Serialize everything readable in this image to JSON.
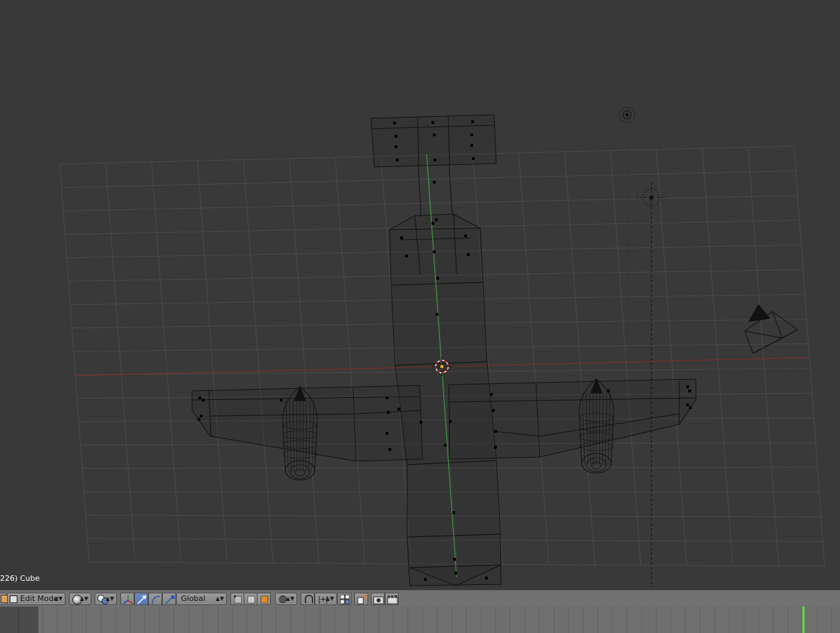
{
  "viewport": {
    "object_label": "226) Cube",
    "colors": {
      "background": "#393939",
      "grid": "#4a4a4a",
      "x_axis": "#8b2a2a",
      "y_axis": "#3fa33f",
      "wire": "#111111",
      "vertex": "#000000",
      "cursor": "#ffffff",
      "origin": "#ff9f1a"
    }
  },
  "header": {
    "editor_type_icon": "3d-view-icon",
    "mode_label": "Edit Mode",
    "viewport_shading_icon": "sphere-shading-icon",
    "pivot_icon": "pivot-center-icon",
    "orientation_label": "Global",
    "transform_widgets": [
      "manipulator-axes-icon",
      "translate-arrow-icon",
      "rotate-arc-icon",
      "scale-arrow-icon"
    ],
    "select_modes": [
      "vertex-select-icon",
      "edge-select-icon",
      "face-select-icon"
    ],
    "proportional_icon": "proportional-circle-icon",
    "snap_icon": "magnet-icon",
    "snap_element_icon": "snap-increment-icon",
    "extra_icons": [
      "snap-target-icon",
      "copy-paste-icon",
      "render-icon",
      "clapper-icon"
    ]
  },
  "timeline": {
    "playhead_color": "#57e639",
    "playhead_frame": 226
  }
}
